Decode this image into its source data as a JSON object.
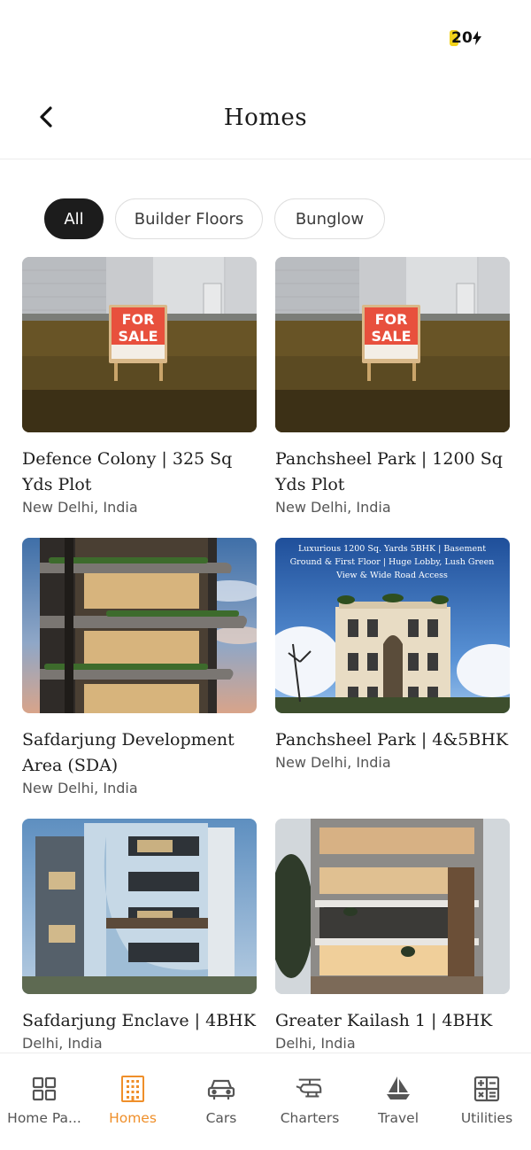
{
  "status_bar": {
    "battery": "20"
  },
  "header": {
    "title": "Homes"
  },
  "filters": [
    {
      "label": "All",
      "active": true
    },
    {
      "label": "Builder Floors",
      "active": false
    },
    {
      "label": "Bunglow",
      "active": false
    }
  ],
  "listings": [
    {
      "title": "Defence Colony | 325 Sq Yds Plot",
      "location": "New Delhi, India",
      "image": "for-sale-sign-photo",
      "sign_text": [
        "FOR",
        "SALE"
      ]
    },
    {
      "title": "Panchsheel Park | 1200 Sq Yds Plot",
      "location": "New Delhi, India",
      "image": "for-sale-sign-photo",
      "sign_text": [
        "FOR",
        "SALE"
      ]
    },
    {
      "title": "Safdarjung Development Area (SDA)",
      "location": "New Delhi, India",
      "image": "modern-terraced-building-photo"
    },
    {
      "title": "Panchsheel Park | 4&5BHK",
      "location": "New Delhi, India",
      "image": "classic-facade-building-photo",
      "banner_text": [
        "Luxurious 1200 Sq. Yards 5BHK | Basement",
        "Ground & First Floor | Huge Lobby, Lush Green",
        "View & Wide Road Access"
      ]
    },
    {
      "title": "Safdarjung Enclave | 4BHK",
      "location": "Delhi, India",
      "image": "contemporary-apartment-building-photo"
    },
    {
      "title": "Greater Kailash 1 | 4BHK",
      "location": "Delhi, India",
      "image": "modern-builder-floor-photo"
    }
  ],
  "bottom_nav": [
    {
      "label": "Home Pa...",
      "icon": "grid-icon",
      "active": false
    },
    {
      "label": "Homes",
      "icon": "building-icon",
      "active": true
    },
    {
      "label": "Cars",
      "icon": "car-icon",
      "active": false
    },
    {
      "label": "Charters",
      "icon": "helicopter-icon",
      "active": false
    },
    {
      "label": "Travel",
      "icon": "sailboat-icon",
      "active": false
    },
    {
      "label": "Utilities",
      "icon": "calculator-icon",
      "active": false
    }
  ],
  "colors": {
    "accent": "#ef8f2a",
    "chip_active_bg": "#1c1c1c",
    "battery_fill": "#f2d21b"
  }
}
